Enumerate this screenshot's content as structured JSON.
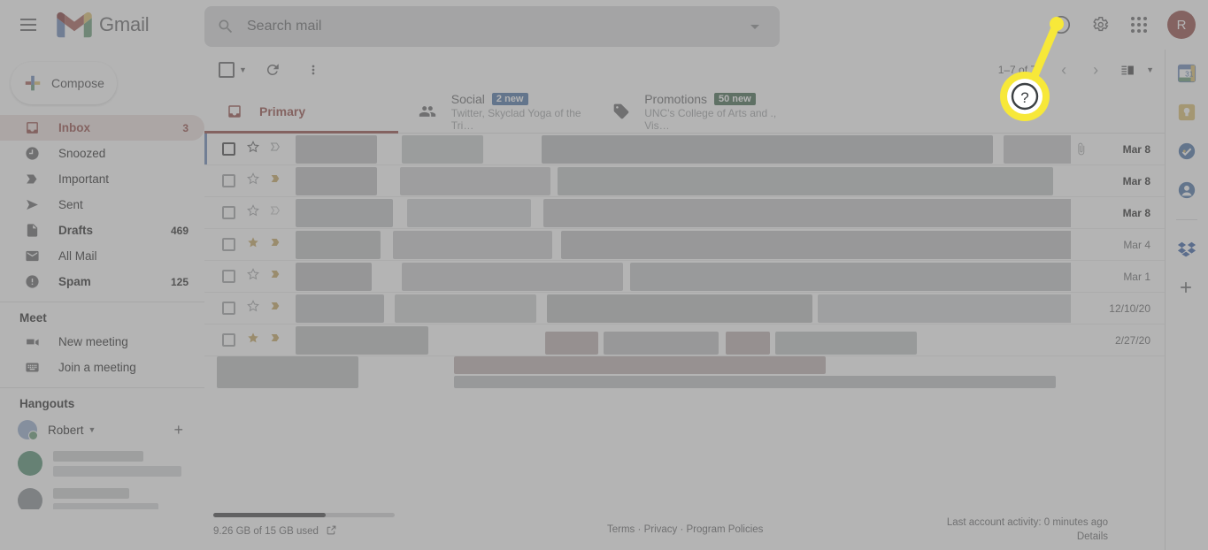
{
  "header": {
    "menu_icon": "hamburger-icon",
    "brand": "Gmail",
    "search": {
      "placeholder": "Search mail",
      "value": "",
      "icon": "search-icon",
      "options_icon": "search-options-icon"
    },
    "help_icon": "help-icon",
    "settings_icon": "gear-icon",
    "apps_icon": "apps-grid-icon",
    "avatar_letter": "R"
  },
  "sidebar": {
    "compose_label": "Compose",
    "items": [
      {
        "label": "Inbox",
        "count": "3",
        "icon": "inbox-icon",
        "active": true,
        "bold": true
      },
      {
        "label": "Snoozed",
        "count": "",
        "icon": "clock-icon",
        "active": false,
        "bold": false
      },
      {
        "label": "Important",
        "count": "",
        "icon": "important-icon",
        "active": false,
        "bold": false
      },
      {
        "label": "Sent",
        "count": "",
        "icon": "send-icon",
        "active": false,
        "bold": false
      },
      {
        "label": "Drafts",
        "count": "469",
        "icon": "draft-icon",
        "active": false,
        "bold": true
      },
      {
        "label": "All Mail",
        "count": "",
        "icon": "mail-icon",
        "active": false,
        "bold": false
      },
      {
        "label": "Spam",
        "count": "125",
        "icon": "spam-icon",
        "active": false,
        "bold": true
      }
    ],
    "meet": {
      "title": "Meet",
      "items": [
        {
          "label": "New meeting",
          "icon": "video-camera-icon"
        },
        {
          "label": "Join a meeting",
          "icon": "keyboard-icon"
        }
      ]
    },
    "hangouts": {
      "title": "Hangouts",
      "user": "Robert",
      "status_caret": "chevron-down-icon",
      "add_icon": "plus-icon",
      "tabs": [
        {
          "icon": "person-icon",
          "active": false
        },
        {
          "icon": "chat-bubble-icon",
          "active": true
        },
        {
          "icon": "phone-icon",
          "active": false
        }
      ]
    }
  },
  "toolbar": {
    "select_all_icon": "checkbox-icon",
    "select_caret_icon": "chevron-down-icon",
    "refresh_icon": "refresh-icon",
    "more_icon": "more-vertical-icon",
    "page_range": "1–7 of 7",
    "prev_icon": "chevron-left-icon",
    "next_icon": "chevron-right-icon",
    "split_pane_icon": "split-pane-icon",
    "split_caret_icon": "chevron-down-icon"
  },
  "tabs": [
    {
      "name": "Primary",
      "subtitle": "",
      "badge": "",
      "badge_color": "",
      "icon": "inbox-icon",
      "active": true
    },
    {
      "name": "Social",
      "subtitle": "Twitter, Skyclad Yoga of the Tri…",
      "badge": "2 new",
      "badge_color": "#1a73e8",
      "icon": "people-icon",
      "active": false
    },
    {
      "name": "Promotions",
      "subtitle": "UNC's College of Arts and ., Vis…",
      "badge": "50 new",
      "badge_color": "#137333",
      "icon": "tag-icon",
      "active": false
    }
  ],
  "mail_rows": [
    {
      "date": "Mar 8",
      "unread": true,
      "starred": false,
      "important": false,
      "attachment": true,
      "selected": true
    },
    {
      "date": "Mar 8",
      "unread": true,
      "starred": false,
      "important": true,
      "attachment": false,
      "selected": false
    },
    {
      "date": "Mar 8",
      "unread": true,
      "starred": false,
      "important": false,
      "attachment": false,
      "selected": false
    },
    {
      "date": "Mar 4",
      "unread": false,
      "starred": true,
      "important": true,
      "attachment": false,
      "selected": false
    },
    {
      "date": "Mar 1",
      "unread": false,
      "starred": false,
      "important": true,
      "attachment": false,
      "selected": false
    },
    {
      "date": "12/10/20",
      "unread": false,
      "starred": false,
      "important": true,
      "attachment": false,
      "selected": false
    },
    {
      "date": "2/27/20",
      "unread": false,
      "starred": true,
      "important": true,
      "attachment": false,
      "selected": false
    }
  ],
  "rail": [
    {
      "icon": "google-calendar-icon"
    },
    {
      "icon": "google-keep-icon"
    },
    {
      "icon": "google-tasks-icon"
    },
    {
      "icon": "google-contacts-icon"
    },
    {
      "icon": "divider"
    },
    {
      "icon": "dropbox-icon"
    },
    {
      "icon": "add-addon-icon"
    }
  ],
  "footer": {
    "storage_text": "9.26 GB of 15 GB used",
    "storage_percent": 62,
    "storage_link_icon": "external-link-icon",
    "terms": "Terms",
    "privacy": "Privacy",
    "program_policies": "Program Policies",
    "separator": "·",
    "activity": "Last account activity: 0 minutes ago",
    "details": "Details"
  },
  "annotation": {
    "callout_symbol": "?",
    "highlight_color": "#f7e839",
    "target": "help-icon"
  },
  "colors": {
    "accent_red": "#d93025",
    "blue": "#1a73e8",
    "green": "#137333",
    "star_gold": "#e8a100"
  }
}
